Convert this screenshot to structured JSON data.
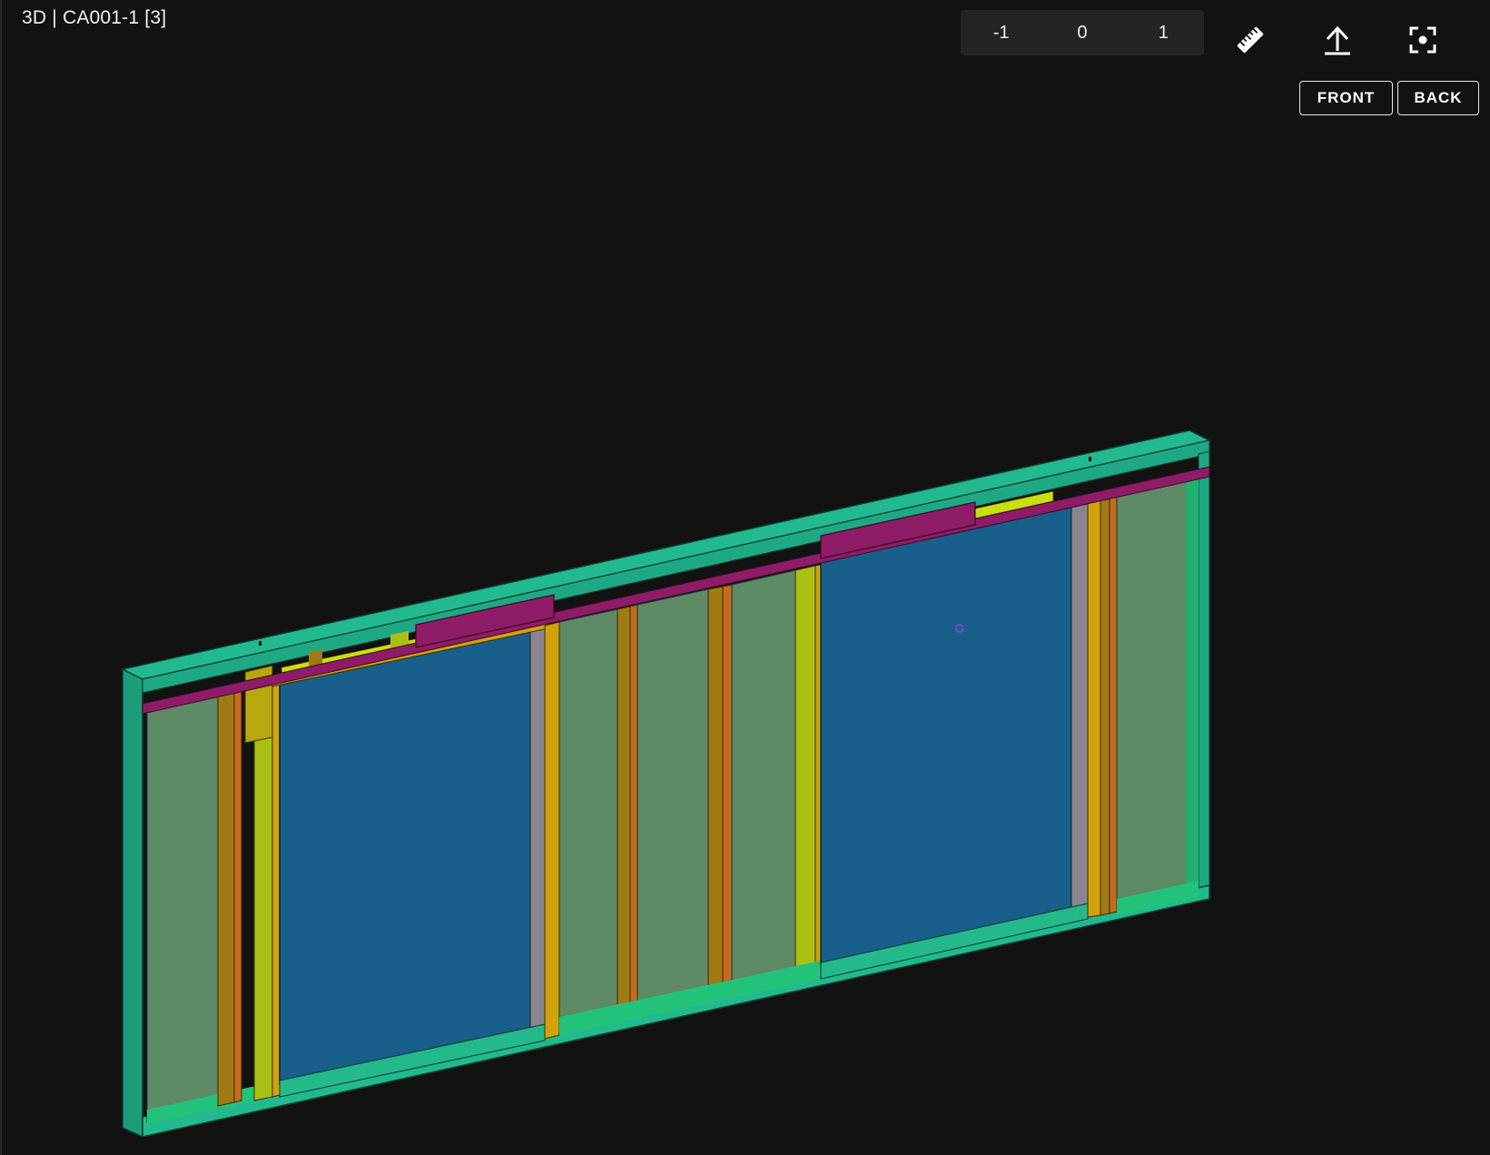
{
  "header": {
    "title": "3D | CA001-1 [3]"
  },
  "level_selector": {
    "options": [
      "-1",
      "0",
      "1"
    ]
  },
  "toolbar": {
    "icons": [
      "ruler-icon",
      "upload-icon",
      "focus-icon"
    ]
  },
  "view_buttons": {
    "front_label": "FRONT",
    "back_label": "BACK"
  },
  "model_colors": {
    "frame": "#22b98e",
    "frame_top": "#1fa884",
    "bay_panel": "#5f8a66",
    "window_glass": "#185f8c",
    "stud_yellow": "#a9bf14",
    "stud_orange": "#c86a1e",
    "beam_magenta": "#8e1c66",
    "jamb_grey": "#8a8490"
  }
}
